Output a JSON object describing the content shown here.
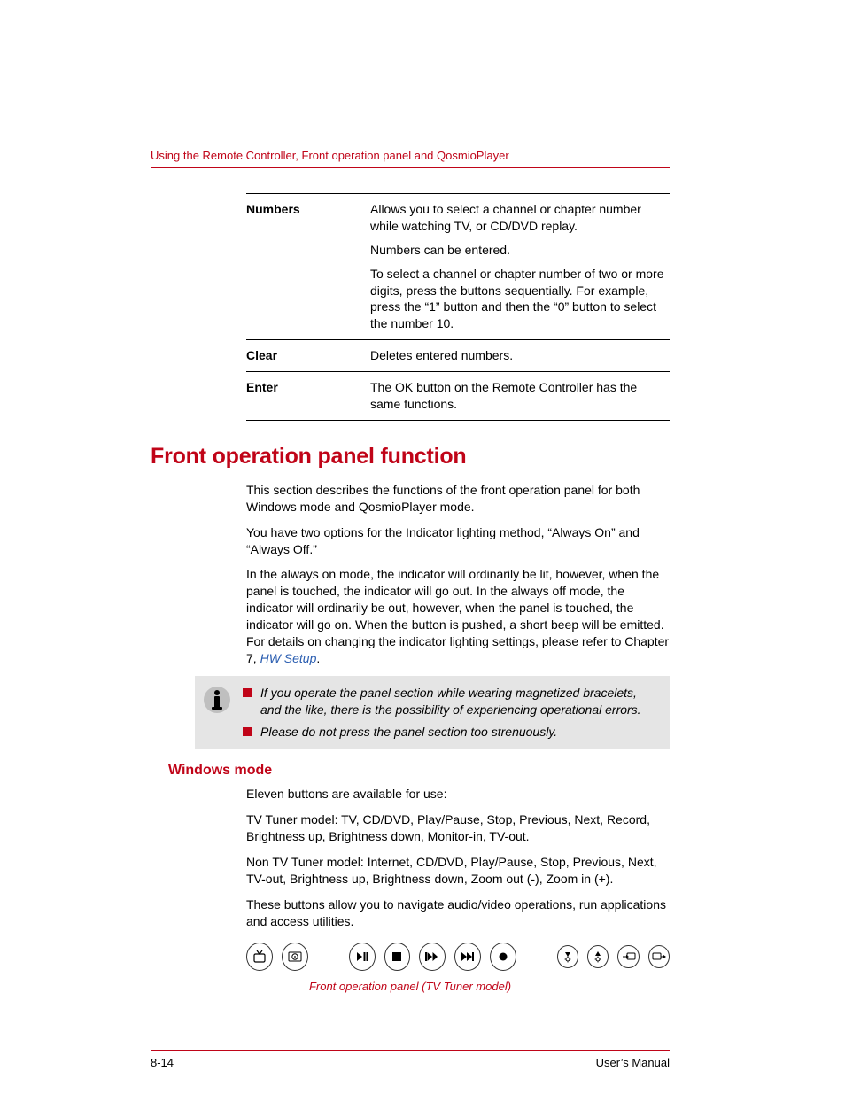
{
  "running_head": "Using the Remote Controller, Front operation panel and QosmioPlayer",
  "table": {
    "rows": [
      {
        "term": "Numbers",
        "paras": [
          "Allows you to select a channel or chapter number while watching TV, or CD/DVD replay.",
          "Numbers can be entered.",
          "To select a channel or chapter number of two or more digits, press the buttons sequentially. For example, press the “1” button and then the “0” button to select the number 10."
        ]
      },
      {
        "term": "Clear",
        "paras": [
          "Deletes entered numbers."
        ]
      },
      {
        "term": "Enter",
        "paras": [
          "The OK button on the Remote Controller has the same functions."
        ]
      }
    ]
  },
  "section_heading": "Front operation panel function",
  "section_body": {
    "p1": "This section describes the functions of the front operation panel for both Windows mode and QosmioPlayer mode.",
    "p2": "You have two options for the Indicator lighting method, “Always On” and “Always Off.”",
    "p3_pre": "In the always on mode, the indicator will ordinarily be lit, however, when the panel is touched, the indicator will go out. In the always off mode, the indicator will ordinarily be out, however, when the panel is touched, the indicator will go on. When the button is pushed, a short beep will be emitted. For details on changing the indicator lighting settings, please refer to Chapter 7, ",
    "p3_link": "HW Setup",
    "p3_post": "."
  },
  "note": {
    "item1": "If you operate the panel section while wearing magnetized bracelets, and the like, there is the possibility of experiencing operational errors.",
    "item2": "Please do not press the panel section too strenuously."
  },
  "subsection_heading": "Windows mode",
  "subsection_body": {
    "p1": "Eleven buttons are available for use:",
    "p2": "TV Tuner model: TV, CD/DVD, Play/Pause, Stop, Previous, Next, Record, Brightness up, Brightness down, Monitor-in, TV-out.",
    "p3": "Non TV Tuner model: Internet, CD/DVD, Play/Pause, Stop, Previous, Next, TV-out, Brightness up, Brightness down, Zoom out (-), Zoom in (+).",
    "p4": "These buttons allow you to navigate audio/video operations, run applications and access utilities."
  },
  "caption": "Front operation panel (TV Tuner model)",
  "footer": {
    "page": "8-14",
    "manual": "User’s Manual"
  },
  "panel_buttons": [
    "tv-icon",
    "cd-dvd-icon",
    "play-pause-icon",
    "stop-icon",
    "previous-icon",
    "next-icon",
    "record-icon",
    "brightness-down-icon",
    "brightness-up-icon",
    "monitor-in-icon",
    "tv-out-icon"
  ]
}
